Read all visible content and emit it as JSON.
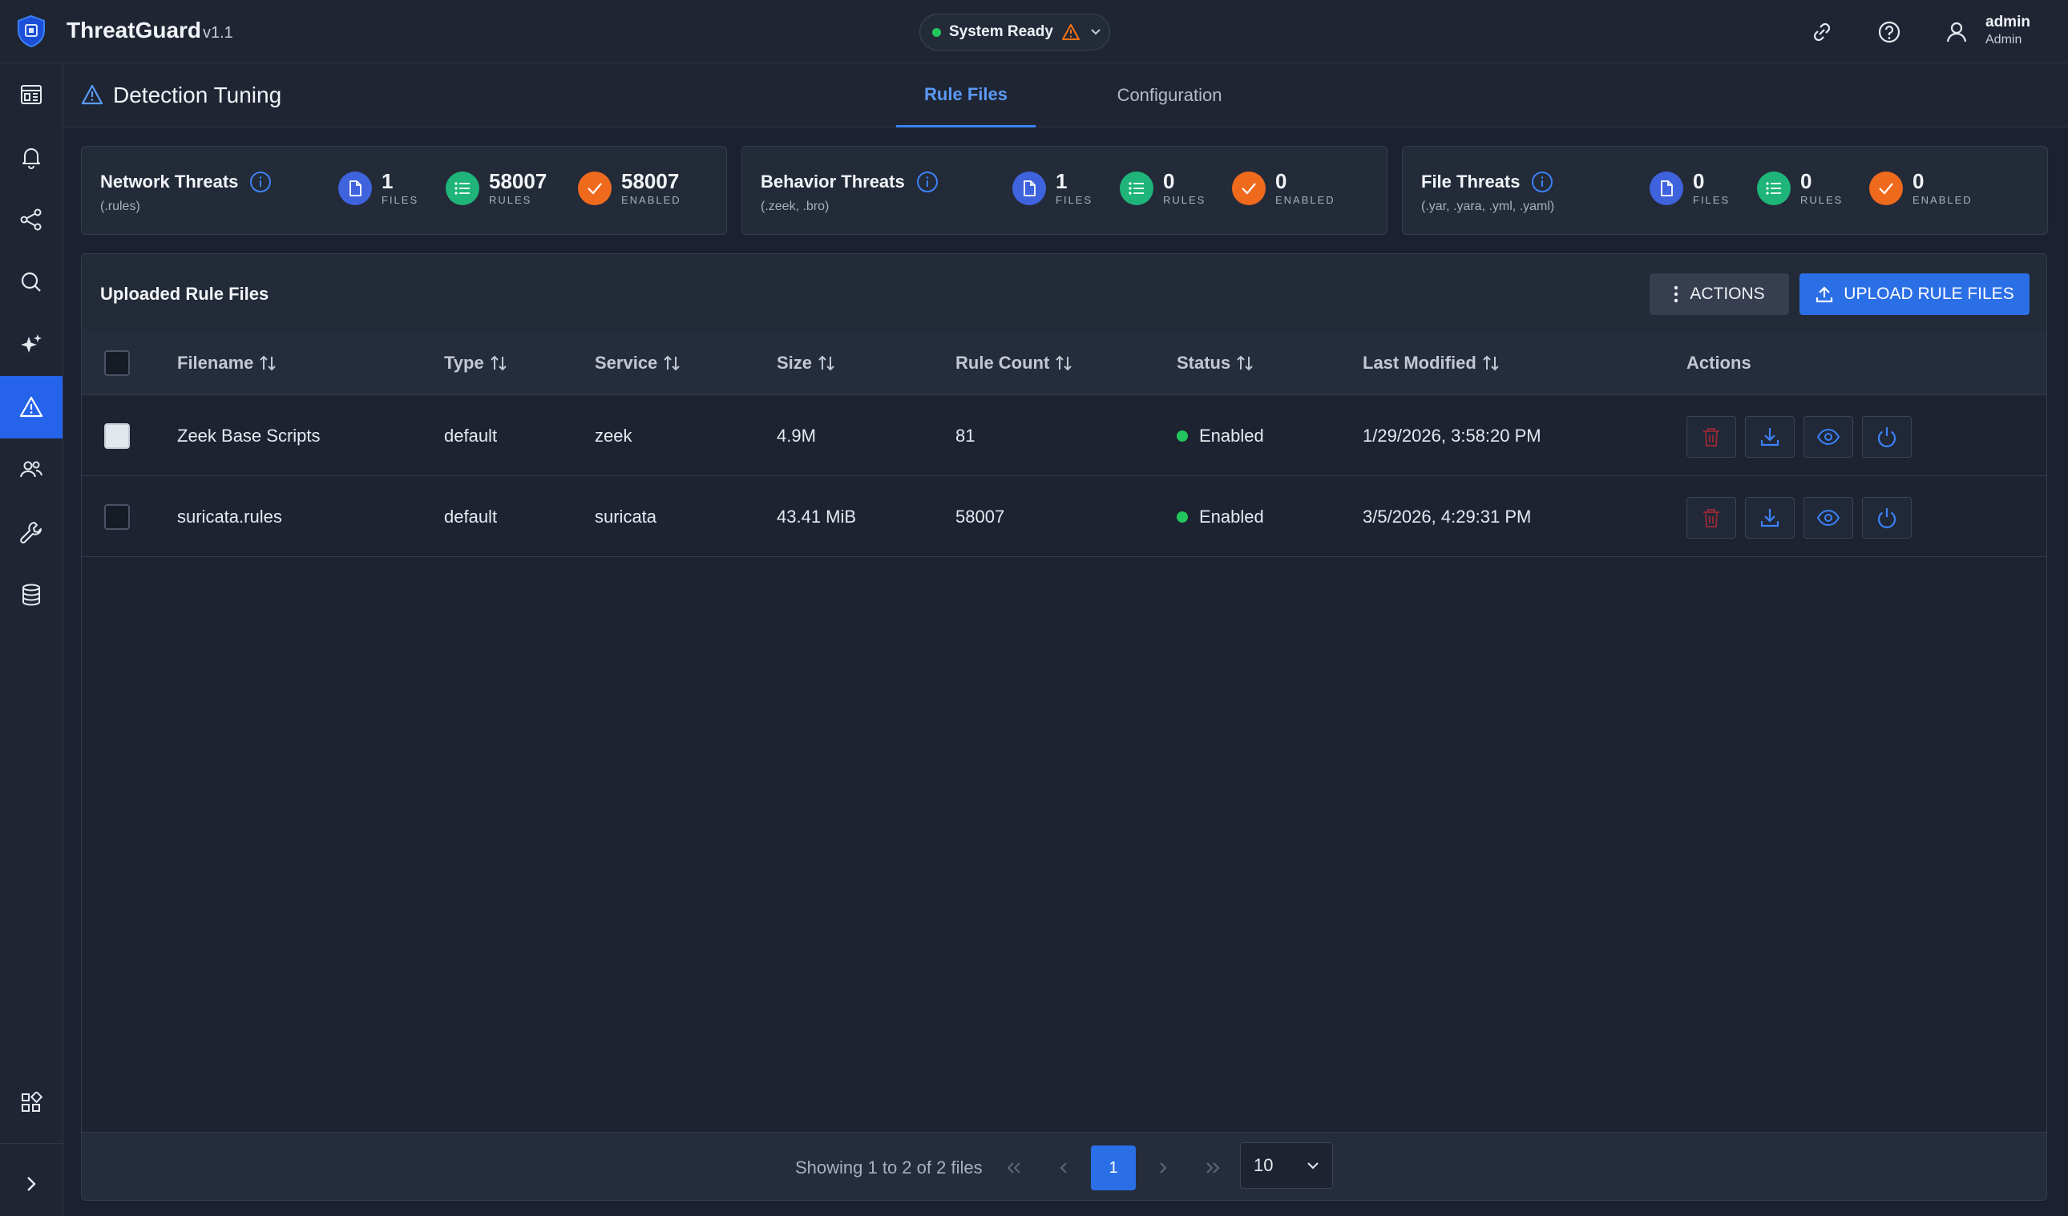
{
  "app": {
    "name": "ThreatGuard",
    "version": "v1.1"
  },
  "system_status": {
    "label": "System Ready",
    "dot_color": "#22c55e",
    "warning_color": "#f97316"
  },
  "user": {
    "name": "admin",
    "role": "Admin"
  },
  "top_icons": [
    "link-icon",
    "help-icon",
    "user-icon"
  ],
  "sidebar": {
    "items": [
      {
        "name": "dashboard",
        "icon": "dashboard-icon",
        "active": false
      },
      {
        "name": "alerts",
        "icon": "bell-icon",
        "active": false
      },
      {
        "name": "connections",
        "icon": "share-nodes-icon",
        "active": false
      },
      {
        "name": "search",
        "icon": "search-icon",
        "active": false
      },
      {
        "name": "ai",
        "icon": "sparkles-icon",
        "active": false
      },
      {
        "name": "detection",
        "icon": "warning-triangle-icon",
        "active": true
      },
      {
        "name": "users",
        "icon": "users-icon",
        "active": false
      },
      {
        "name": "tools",
        "icon": "wrench-icon",
        "active": false
      },
      {
        "name": "storage",
        "icon": "database-icon",
        "active": false
      },
      {
        "name": "apps",
        "icon": "apps-grid-icon",
        "active": false
      },
      {
        "name": "expand",
        "icon": "chevron-right-icon",
        "active": false
      }
    ]
  },
  "page": {
    "title": "Detection Tuning",
    "tabs": [
      {
        "label": "Rule Files",
        "active": true
      },
      {
        "label": "Configuration",
        "active": false
      }
    ]
  },
  "cards": [
    {
      "title": "Network Threats",
      "subtitle": "(.rules)",
      "stats": [
        {
          "value": "1",
          "label": "FILES"
        },
        {
          "value": "58007",
          "label": "RULES"
        },
        {
          "value": "58007",
          "label": "ENABLED"
        }
      ]
    },
    {
      "title": "Behavior Threats",
      "subtitle": "(.zeek, .bro)",
      "stats": [
        {
          "value": "1",
          "label": "FILES"
        },
        {
          "value": "0",
          "label": "RULES"
        },
        {
          "value": "0",
          "label": "ENABLED"
        }
      ]
    },
    {
      "title": "File Threats",
      "subtitle": "(.yar, .yara, .yml, .yaml)",
      "stats": [
        {
          "value": "0",
          "label": "FILES"
        },
        {
          "value": "0",
          "label": "RULES"
        },
        {
          "value": "0",
          "label": "ENABLED"
        }
      ]
    }
  ],
  "table": {
    "title": "Uploaded Rule Files",
    "actions_button": "ACTIONS",
    "upload_button": "UPLOAD RULE FILES",
    "columns": [
      "Filename",
      "Type",
      "Service",
      "Size",
      "Rule Count",
      "Status",
      "Last Modified",
      "Actions"
    ],
    "rows": [
      {
        "filename": "Zeek Base Scripts",
        "type": "default",
        "service": "zeek",
        "size": "4.9M",
        "rule_count": "81",
        "status": "Enabled",
        "last_modified": "1/29/2026, 3:58:20 PM"
      },
      {
        "filename": "suricata.rules",
        "type": "default",
        "service": "suricata",
        "size": "43.41 MiB",
        "rule_count": "58007",
        "status": "Enabled",
        "last_modified": "3/5/2026, 4:29:31 PM"
      }
    ],
    "row_action_icons": [
      "trash-icon",
      "download-icon",
      "eye-icon",
      "power-icon"
    ]
  },
  "pagination": {
    "summary": "Showing 1 to 2 of 2 files",
    "current_page": "1",
    "per_page": "10"
  },
  "colors": {
    "accent": "#2b6fe6",
    "active_nav": "#2563eb",
    "enabled": "#22c55e",
    "danger": "#c0303f"
  }
}
